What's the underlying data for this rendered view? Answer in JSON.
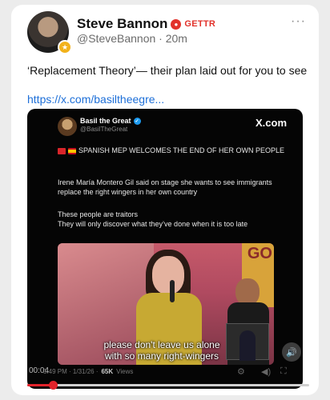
{
  "post": {
    "author_name": "Steve Bannon",
    "platform_label": "GETTR",
    "handle": "@SteveBannon",
    "separator": "·",
    "age": "20m",
    "more_label": "···",
    "text": "‘Replacement Theory’— their plan laid out for you to see",
    "link": "https://x.com/basiltheegre..."
  },
  "embed": {
    "author_name": "Basil the Great",
    "handle": "@BasilTheGreat",
    "brand": "X.com",
    "headline": "SPANISH MEP WELCOMES THE END OF HER OWN PEOPLE",
    "paragraph_1": "Irene María Montero Gil said on stage she wants to see immigrants replace the right wingers in her own country",
    "paragraph_2_line_1": "These people are traitors",
    "paragraph_2_line_2": "They will only discover what they’ve done when it is too late",
    "video": {
      "poster_text": "GO",
      "caption_line_1": "please don't leave us alone",
      "caption_line_2": "with so many right-wingers",
      "volume_icon": "speaker-icon",
      "elapsed": "00:04"
    },
    "timestamp": "3:49 PM · 1/31/26 ·",
    "views_count": "65K",
    "views_label": "Views"
  },
  "player": {
    "progress_fraction": 0.09
  },
  "colors": {
    "accent_red": "#e2322b",
    "link_blue": "#1d6fd8"
  }
}
